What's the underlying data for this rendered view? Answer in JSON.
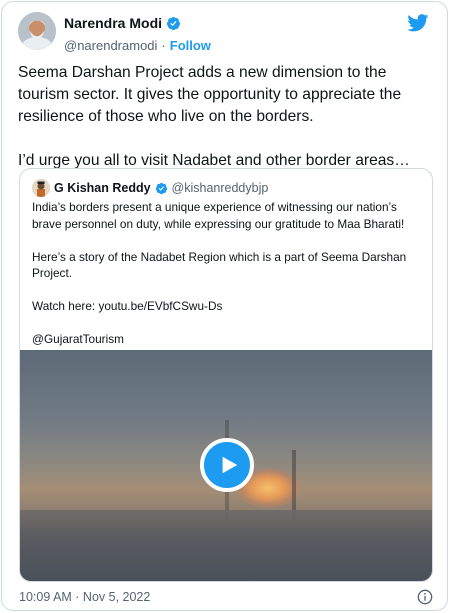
{
  "tweet": {
    "author": {
      "name": "Narendra Modi",
      "handle": "@narendramodi",
      "follow_separator": "·",
      "follow_label": "Follow"
    },
    "paragraphs": [
      "Seema Darshan Project adds a new dimension to the tourism sector. It gives the opportunity to appreciate the resilience of those who live on the borders.",
      "I’d urge you all to visit Nadabet and other border areas…"
    ],
    "timestamp": "10:09 AM · Nov 5, 2022"
  },
  "quoted_tweet": {
    "author": {
      "name": "G Kishan Reddy",
      "handle": "@kishanreddybjp"
    },
    "paragraphs": [
      "India’s borders present a unique experience of witnessing our nation’s brave personnel on duty, while expressing our gratitude to Maa Bharati!",
      "Here’s a story of the Nadabet Region which is a part of Seema Darshan Project.",
      "Watch here: youtu.be/EVbfCSwu-Ds",
      "@GujaratTourism"
    ]
  },
  "colors": {
    "accent": "#1d9bf0",
    "text": "#0f1419",
    "secondary_text": "#536471",
    "border": "#cfd9de"
  },
  "icons": [
    "verified-badge-icon",
    "twitter-bird-icon",
    "play-icon",
    "info-icon"
  ]
}
